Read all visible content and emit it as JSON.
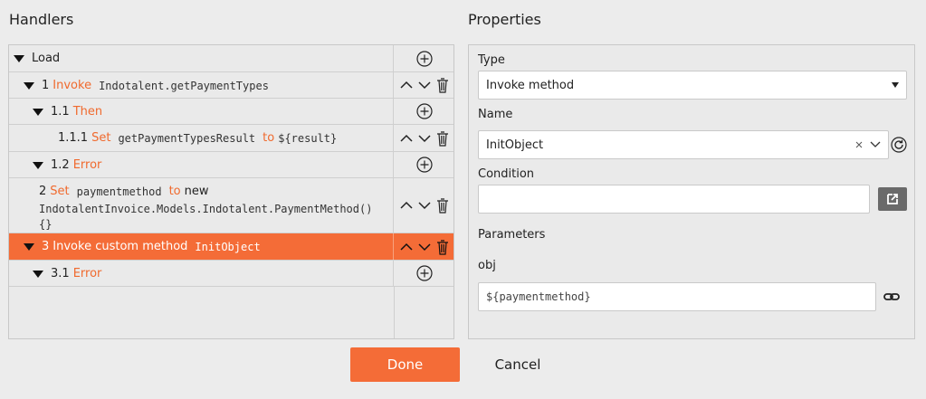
{
  "handlers": {
    "title": "Handlers",
    "rows": [
      {
        "num": "",
        "label": "Load",
        "keyword": "",
        "code": ""
      },
      {
        "num": "1",
        "keyword": "Invoke",
        "code": "Indotalent.getPaymentTypes"
      },
      {
        "num": "1.1",
        "keyword": "Then",
        "code": ""
      },
      {
        "num": "1.1.1",
        "keyword": "Set",
        "code": "getPaymentTypesResult",
        "to": "to",
        "value": "${result}"
      },
      {
        "num": "1.2",
        "keyword": "Error",
        "code": ""
      },
      {
        "num": "2",
        "keyword": "Set",
        "code": "paymentmethod",
        "to": "to",
        "value": "new",
        "line2": "IndotalentInvoice.Models.Indotalent.PaymentMethod()",
        "line3": "{}"
      },
      {
        "num": "3",
        "keyword": "Invoke custom method",
        "code": "InitObject"
      },
      {
        "num": "3.1",
        "keyword": "Error",
        "code": ""
      }
    ]
  },
  "properties": {
    "title": "Properties",
    "type_label": "Type",
    "type_value": "Invoke method",
    "name_label": "Name",
    "name_value": "InitObject",
    "condition_label": "Condition",
    "condition_value": "",
    "parameters_label": "Parameters",
    "param_name": "obj",
    "param_value": "${paymentmethod}"
  },
  "buttons": {
    "done": "Done",
    "cancel": "Cancel"
  },
  "colors": {
    "accent": "#f46c37",
    "keyword": "#f06a2e"
  }
}
